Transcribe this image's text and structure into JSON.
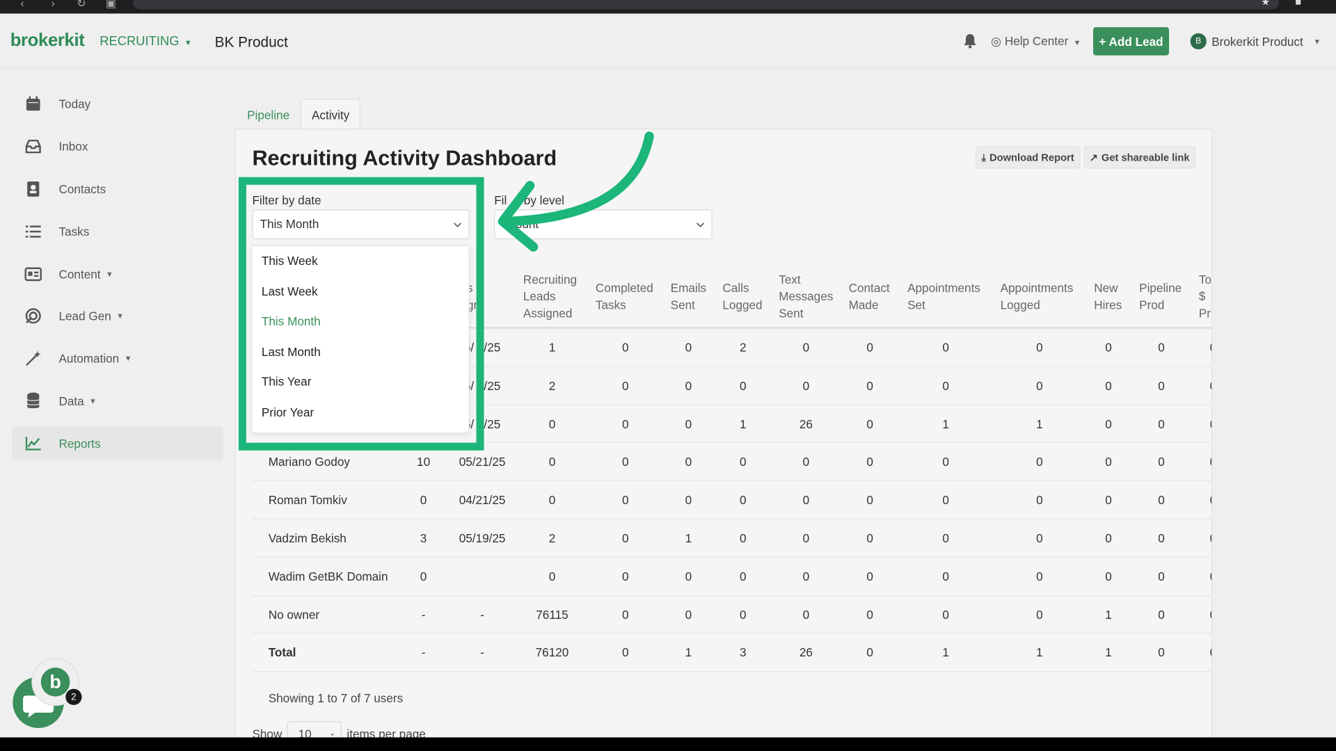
{
  "header": {
    "logo": "brokerkit",
    "module": "RECRUITING",
    "org": "BK Product",
    "help": "Help Center",
    "add_lead": "+ Add Lead",
    "user": "Brokerkit Product",
    "avatar_initial": "B"
  },
  "sidebar": {
    "items": [
      {
        "label": "Today",
        "icon": "calendar-icon"
      },
      {
        "label": "Inbox",
        "icon": "inbox-icon"
      },
      {
        "label": "Contacts",
        "icon": "contacts-icon"
      },
      {
        "label": "Tasks",
        "icon": "tasks-icon"
      },
      {
        "label": "Content",
        "icon": "content-icon"
      },
      {
        "label": "Lead Gen",
        "icon": "lead-gen-icon"
      },
      {
        "label": "Automation",
        "icon": "automation-icon"
      },
      {
        "label": "Data",
        "icon": "database-icon"
      },
      {
        "label": "Reports",
        "icon": "chart-icon"
      }
    ]
  },
  "tabs": {
    "pipeline": "Pipeline",
    "activity": "Activity"
  },
  "panel": {
    "title": "Recruiting Activity Dashboard",
    "download": "Download Report",
    "share": "Get shareable link",
    "filter_date_label": "Filter by date",
    "filter_date_value": "This Month",
    "filter_level_label_partial": "Fil",
    "filter_level_label_rest": "by level",
    "filter_level_value_partial": "ount"
  },
  "dropdown": {
    "options": [
      "This Week",
      "Last Week",
      "This Month",
      "Last Month",
      "This Year",
      "Prior Year"
    ],
    "selected": "This Month"
  },
  "table": {
    "headers": {
      "h_partial_1a": "s",
      "h_partial_1b": "gn",
      "recruiting": "Recruiting Leads Assigned",
      "completed": "Completed Tasks",
      "emails": "Emails Sent",
      "calls": "Calls Logged",
      "texts": "Text Messages Sent",
      "contact": "Contact Made",
      "appt_set": "Appointments Set",
      "appt_logged": "Appointments Logged",
      "hires": "New Hires",
      "pipeline": "Pipeline Prod",
      "total_partial": "To $ Pr"
    },
    "rows": [
      {
        "name": "",
        "a": "",
        "d": "5/ 2/25",
        "c": [
          "1",
          "0",
          "0",
          "2",
          "0",
          "0",
          "0",
          "0",
          "0",
          "0"
        ]
      },
      {
        "name": "",
        "a": "",
        "d": "5/ 2/25",
        "c": [
          "2",
          "0",
          "0",
          "0",
          "0",
          "0",
          "0",
          "0",
          "0",
          "0"
        ]
      },
      {
        "name": "",
        "a": "",
        "d": "5/ 2/25",
        "c": [
          "0",
          "0",
          "0",
          "1",
          "26",
          "0",
          "1",
          "1",
          "0",
          "0"
        ]
      },
      {
        "name": "Mariano Godoy",
        "a": "10",
        "d": "05/21/25",
        "c": [
          "0",
          "0",
          "0",
          "0",
          "0",
          "0",
          "0",
          "0",
          "0",
          "0"
        ]
      },
      {
        "name": "Roman Tomkiv",
        "a": "0",
        "d": "04/21/25",
        "c": [
          "0",
          "0",
          "0",
          "0",
          "0",
          "0",
          "0",
          "0",
          "0",
          "0"
        ]
      },
      {
        "name": "Vadzim Bekish",
        "a": "3",
        "d": "05/19/25",
        "c": [
          "2",
          "0",
          "1",
          "0",
          "0",
          "0",
          "0",
          "0",
          "0",
          "0"
        ]
      },
      {
        "name": "Wadim GetBK Domain",
        "a": "0",
        "d": "",
        "c": [
          "0",
          "0",
          "0",
          "0",
          "0",
          "0",
          "0",
          "0",
          "0",
          "0"
        ]
      },
      {
        "name": "No owner",
        "a": "-",
        "d": "-",
        "c": [
          "76115",
          "0",
          "0",
          "0",
          "0",
          "0",
          "0",
          "0",
          "1",
          "0"
        ]
      },
      {
        "name": "Total",
        "a": "-",
        "d": "-",
        "c": [
          "76120",
          "0",
          "1",
          "3",
          "26",
          "0",
          "1",
          "1",
          "1",
          "0"
        ]
      }
    ],
    "showing": "Showing 1 to 7 of 7 users",
    "show_label": "Show",
    "per_page_value": "10",
    "per_page_suffix": "items per page"
  },
  "chat": {
    "letter": "b",
    "badge": "2"
  },
  "colors": {
    "brand": "#3a8f5c",
    "highlight": "#1cb57a"
  }
}
